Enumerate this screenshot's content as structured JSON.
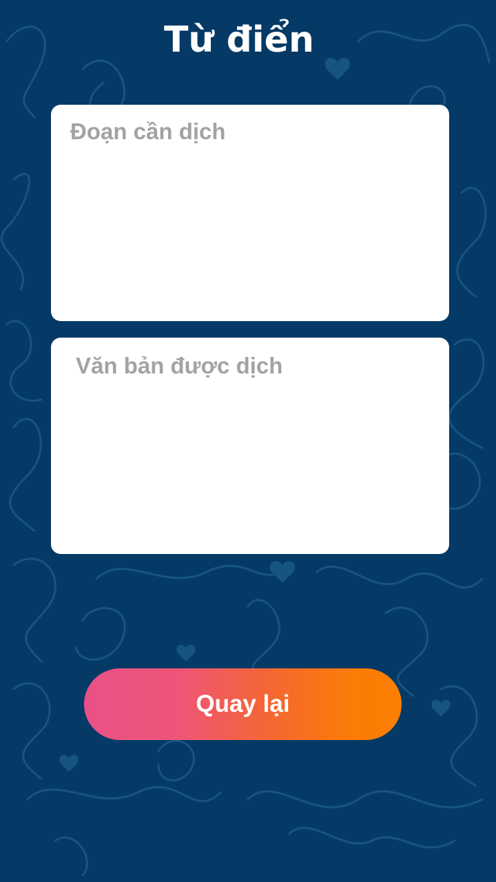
{
  "header": {
    "title": "Từ điển"
  },
  "source_box": {
    "placeholder": "Đoạn cần dịch",
    "value": ""
  },
  "target_box": {
    "placeholder": "Văn bản được dịch",
    "value": ""
  },
  "footer": {
    "back_label": "Quay lại"
  },
  "colors": {
    "background": "#053a66",
    "pattern": "#1f6896",
    "box_background": "#ffffff",
    "placeholder": "#a3a3a3",
    "button_gradient_start": "#e95187",
    "button_gradient_end": "#fc7e02"
  },
  "decoration": {
    "background_icon": "doodle-hearts-words-pattern"
  }
}
